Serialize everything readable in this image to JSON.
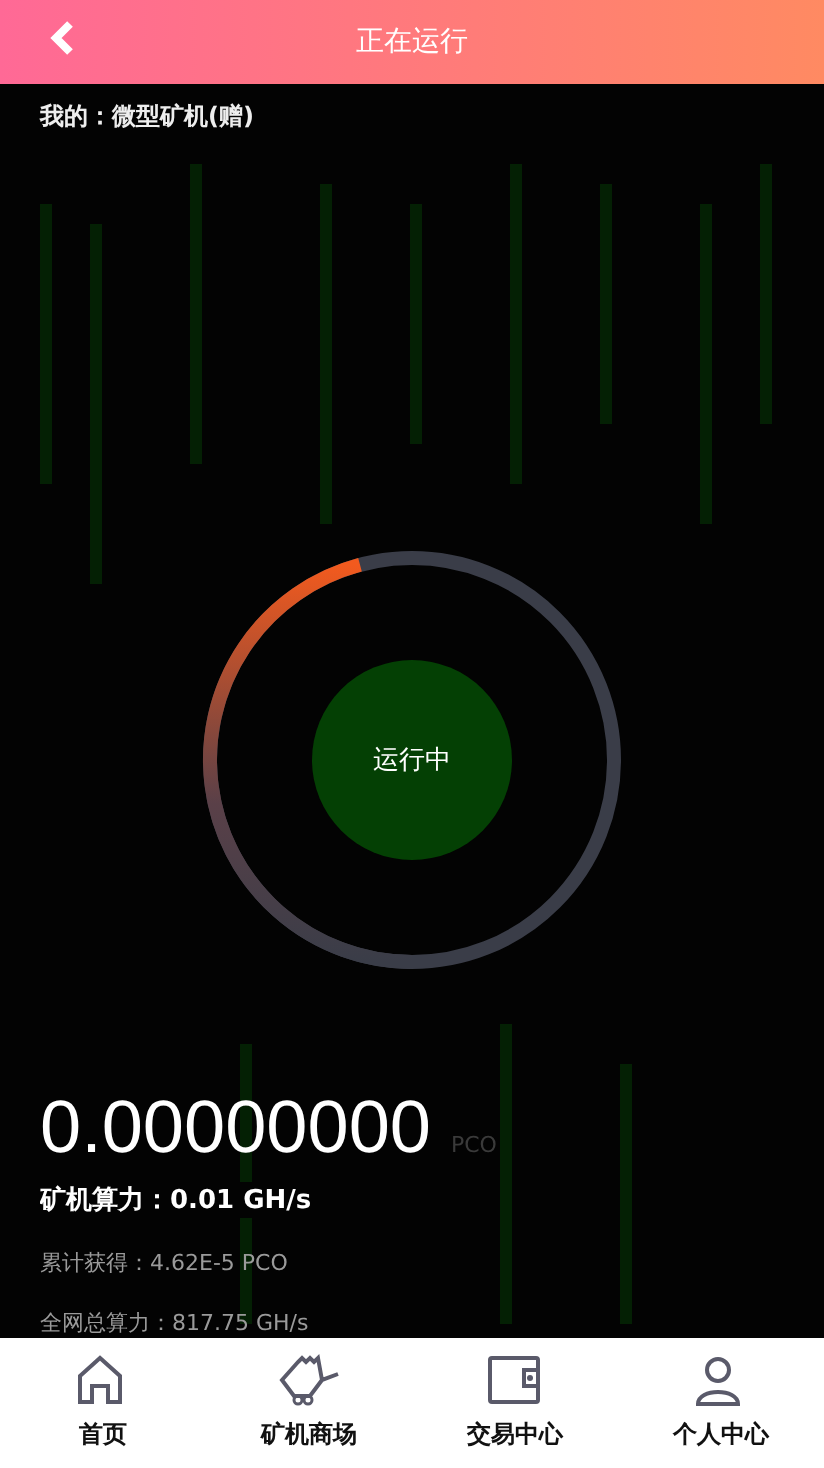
{
  "header": {
    "title": "正在运行"
  },
  "machine": {
    "label": "我的：微型矿机(赠)"
  },
  "status": {
    "text": "运行中",
    "running": true
  },
  "balance": {
    "value": "0.00000000",
    "unit": "PCO"
  },
  "stats": [
    {
      "kind": "main",
      "text": "矿机算力：0.01 GH/s"
    },
    {
      "kind": "sub",
      "text": "累计获得：4.62E-5 PCO"
    },
    {
      "kind": "sub",
      "text": "全网总算力：817.75 GH/s"
    }
  ],
  "nav": [
    {
      "kind": "home",
      "label": "首页"
    },
    {
      "kind": "cart",
      "label": "矿机商场"
    },
    {
      "kind": "wallet",
      "label": "交易中心"
    },
    {
      "kind": "user",
      "label": "个人中心"
    }
  ]
}
